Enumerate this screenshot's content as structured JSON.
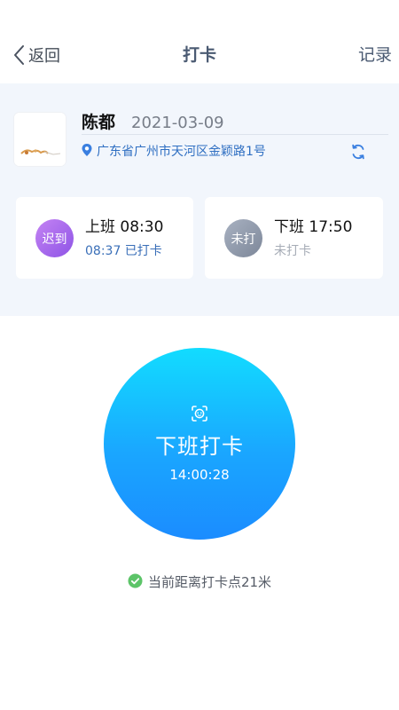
{
  "nav": {
    "back_label": "返回",
    "title": "打卡",
    "records_label": "记录"
  },
  "user": {
    "name": "陈都",
    "date": "2021-03-09",
    "location": "广东省广州市天河区金颖路1号"
  },
  "shifts": [
    {
      "badge": "迟到",
      "title": "上班 08:30",
      "status": "08:37 已打卡"
    },
    {
      "badge": "未打",
      "title": "下班 17:50",
      "status": "未打卡"
    }
  ],
  "punch": {
    "label": "下班打卡",
    "time": "14:00:28"
  },
  "distance_text": "当前距离打卡点21米",
  "icons": {
    "back": "chevron-left-icon",
    "location": "location-pin-icon",
    "refresh": "refresh-icon",
    "face": "face-scan-icon",
    "check": "check-circle-icon"
  },
  "colors": {
    "nav_text": "#4a5a72",
    "panel_bg": "#f2f6fc",
    "location_text": "#2f6fc2",
    "late_badge": "#a36aee",
    "pending_badge": "#8f98a9",
    "punch_gradient_top": "#12dcff",
    "punch_gradient_bottom": "#1b8cff",
    "success_green": "#5cc468"
  }
}
